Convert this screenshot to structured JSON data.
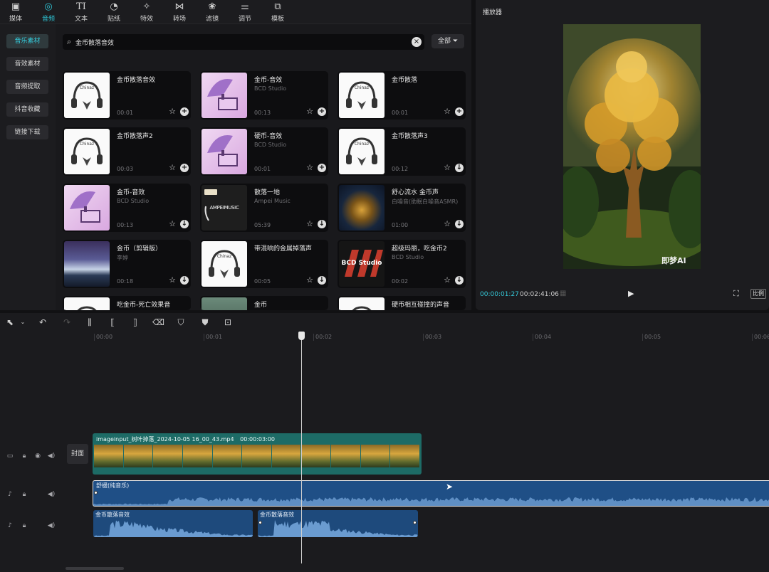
{
  "top_tabs": [
    {
      "label": "媒体",
      "icon": "media-icon"
    },
    {
      "label": "音频",
      "icon": "audio-icon"
    },
    {
      "label": "文本",
      "icon": "text-icon"
    },
    {
      "label": "贴纸",
      "icon": "sticker-icon"
    },
    {
      "label": "特效",
      "icon": "effects-icon"
    },
    {
      "label": "转场",
      "icon": "transition-icon"
    },
    {
      "label": "滤镜",
      "icon": "filter-icon"
    },
    {
      "label": "调节",
      "icon": "adjust-icon"
    },
    {
      "label": "模板",
      "icon": "template-icon"
    }
  ],
  "side_nav": [
    "音乐素材",
    "音效素材",
    "音频提取",
    "抖音收藏",
    "链接下载"
  ],
  "search": {
    "value": "金币散落音效",
    "filter_label": "全部"
  },
  "cards": [
    {
      "title": "金币散落音效",
      "sub": "",
      "dur": "00:01",
      "thumb": "chinaz",
      "thumb_text": "Chinaz",
      "action": "+"
    },
    {
      "title": "金币-音效",
      "sub": "BCD Studio",
      "dur": "00:13",
      "thumb": "gramo",
      "thumb_text": "",
      "action": "+"
    },
    {
      "title": "金币散落",
      "sub": "",
      "dur": "00:01",
      "thumb": "chinaz",
      "thumb_text": "Chinaz",
      "action": "+"
    },
    {
      "title": "金币散落声2",
      "sub": "",
      "dur": "00:03",
      "thumb": "chinaz",
      "thumb_text": "Chinaz",
      "action": "+"
    },
    {
      "title": "硬币-音效",
      "sub": "BCD Studio",
      "dur": "00:01",
      "thumb": "gramo",
      "thumb_text": "",
      "action": "+"
    },
    {
      "title": "金币散落声3",
      "sub": "",
      "dur": "00:12",
      "thumb": "chinaz",
      "thumb_text": "Chinaz",
      "action": "↓"
    },
    {
      "title": "金币-音效",
      "sub": "BCD Studio",
      "dur": "00:13",
      "thumb": "gramo",
      "thumb_text": "",
      "action": "↓"
    },
    {
      "title": "散落一地",
      "sub": "Ampei Music",
      "dur": "05:39",
      "thumb": "vip",
      "thumb_text": "AMPEIMUSIC",
      "action": "↓"
    },
    {
      "title": "舒心流水 金币声",
      "sub": "白噪音(助眠白噪音ASMR)",
      "dur": "01:00",
      "thumb": "gold",
      "thumb_text": "",
      "action": "↓"
    },
    {
      "title": "金币（剪辑版）",
      "sub": "李婷",
      "dur": "00:18",
      "thumb": "mountain",
      "thumb_text": "",
      "action": "↓"
    },
    {
      "title": "带混响的金属掉落声",
      "sub": "",
      "dur": "00:05",
      "thumb": "chinaz",
      "thumb_text": "Chinaz",
      "action": "↓"
    },
    {
      "title": "超级玛丽，吃金币2",
      "sub": "BCD Studio",
      "dur": "00:02",
      "thumb": "bcd",
      "thumb_text": "BCD Studio",
      "action": "↓"
    },
    {
      "title": "吃金币-死亡效果音",
      "sub": "",
      "dur": "",
      "thumb": "chinaz",
      "thumb_text": "",
      "action": ""
    },
    {
      "title": "金币",
      "sub": "",
      "dur": "",
      "thumb": "forest",
      "thumb_text": "",
      "action": ""
    },
    {
      "title": "硬币相互碰撞的声音",
      "sub": "",
      "dur": "",
      "thumb": "chinaz",
      "thumb_text": "",
      "action": ""
    }
  ],
  "player": {
    "title": "播放器",
    "watermark": "即梦AI",
    "time_current": "00:00:01:27",
    "time_total": "00:02:41:06",
    "ratio_label": "比例"
  },
  "timeline": {
    "ticks": [
      "00:00",
      "00:01",
      "00:02",
      "00:03",
      "00:04",
      "00:05",
      "00:06"
    ],
    "cover_label": "封面",
    "video_clip": {
      "name": "imageinput_树叶掉落_2024-10-05 16_00_43.mp4",
      "duration": "00:00:03:00"
    },
    "music_clip": {
      "name": "舒缓(纯音乐)"
    },
    "sfx_clips": [
      {
        "name": "金币散落音效"
      },
      {
        "name": "金币散落音效"
      }
    ]
  },
  "colors": {
    "accent": "#2ec5d6",
    "video_clip": "#1d6b66",
    "audio_clip": "#1f4f86"
  }
}
